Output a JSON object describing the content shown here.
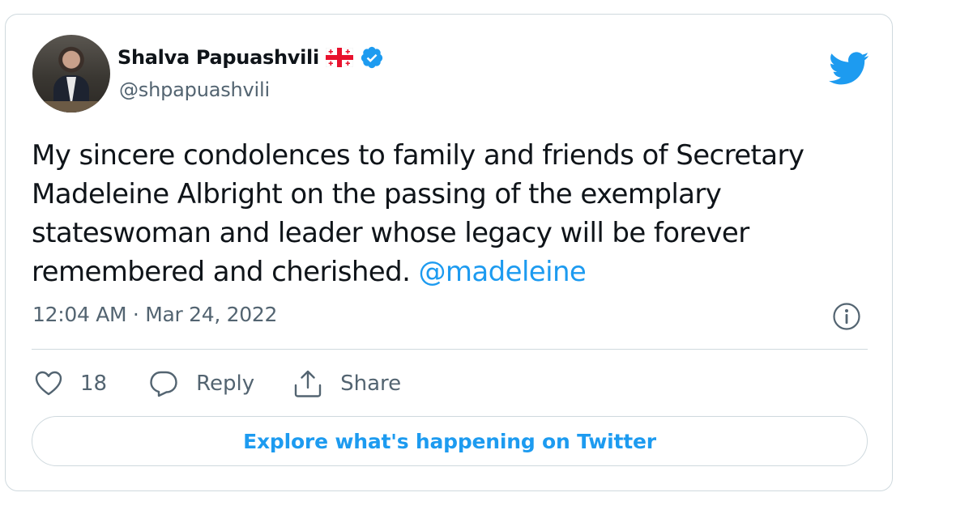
{
  "tweet": {
    "author_name": "Shalva Papuashvili",
    "author_handle": "@shpapuashvili",
    "flag_icon": "georgia-flag-icon",
    "verified_icon": "verified-badge-icon",
    "text_before_mention": "My sincere condolences to family and friends of Secretary Madeleine Albright on the passing of the exemplary stateswoman and leader whose legacy will be forever remembered and cherished. ",
    "mention": "@madeleine",
    "timestamp": "12:04 AM · Mar 24, 2022",
    "like_count": "18",
    "reply_label": "Reply",
    "share_label": "Share",
    "explore_label": "Explore what's happening on Twitter"
  },
  "colors": {
    "accent": "#1d9bf0",
    "text": "#0f1419",
    "secondary": "#536471",
    "border": "#cfd9de",
    "flag_red": "#e8112d"
  }
}
